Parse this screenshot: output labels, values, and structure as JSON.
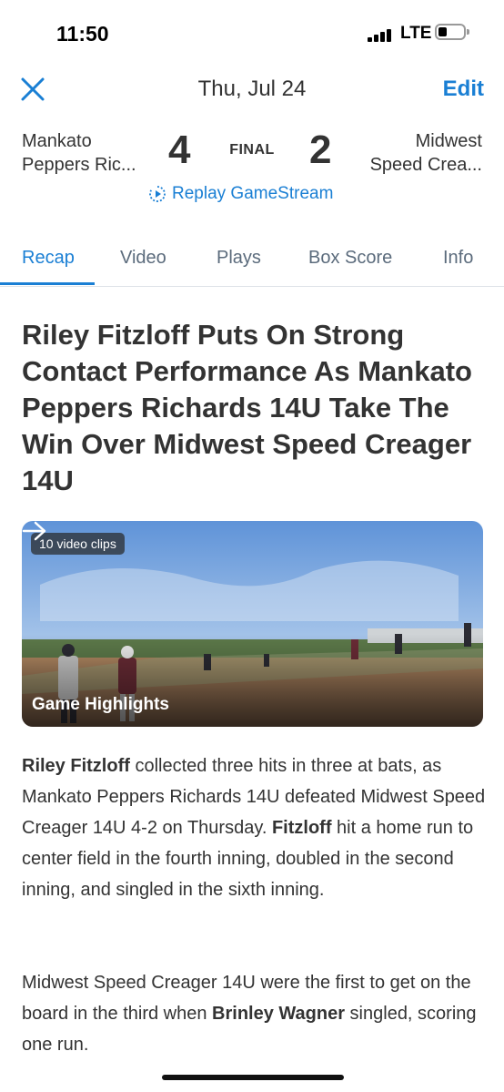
{
  "status": {
    "time": "11:50",
    "network": "LTE"
  },
  "header": {
    "date": "Thu, Jul 24",
    "edit_label": "Edit"
  },
  "game": {
    "home_team": {
      "line1": "Mankato",
      "line2": "Peppers Ric...",
      "score": "4"
    },
    "away_team": {
      "line1": "Midwest",
      "line2": "Speed Crea...",
      "score": "2"
    },
    "status": "FINAL",
    "replay_label": "Replay GameStream"
  },
  "tabs": [
    {
      "label": "Recap",
      "active": true
    },
    {
      "label": "Video"
    },
    {
      "label": "Plays"
    },
    {
      "label": "Box Score"
    },
    {
      "label": "Info"
    }
  ],
  "headline": "Riley Fitzloff Puts On Strong Contact Performance As Mankato Peppers Richards 14U Take The Win Over Midwest Speed Creager 14U",
  "video": {
    "clips_badge": "10 video clips",
    "title": "Game Highlights"
  },
  "paragraph1": {
    "name1": "Riley Fitzloff",
    "text1": " collected three hits in three at bats, as Mankato Peppers Richards 14U defeated Midwest Speed Creager 14U 4-2 on Thursday. ",
    "name2": "Fitzloff",
    "text2": " hit a home run to center field in the fourth inning, doubled in the second inning, and singled in the sixth inning."
  },
  "paragraph2": {
    "text1": "Midwest Speed Creager 14U were the first to get on the board in the third when ",
    "name1": "Brinley Wagner",
    "text2": " singled, scoring one run."
  },
  "colors": {
    "accent": "#1a7fd4",
    "text": "#333333"
  },
  "icons": [
    "close-icon",
    "replay-icon",
    "arrow-right-icon"
  ]
}
